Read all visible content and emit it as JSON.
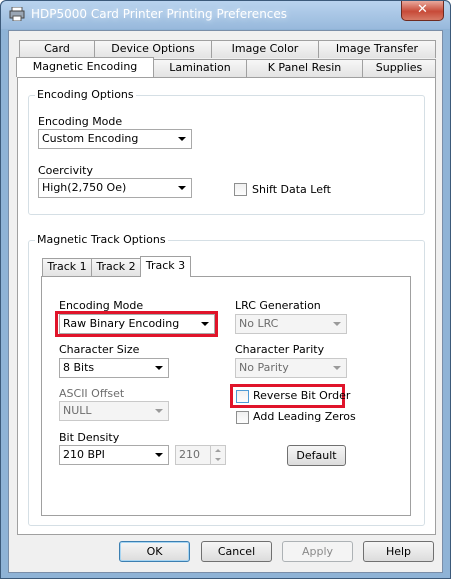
{
  "window": {
    "title": "HDP5000 Card Printer Printing Preferences",
    "close_glyph": "✕"
  },
  "tabs_row1": [
    "Card",
    "Device Options",
    "Image Color",
    "Image Transfer"
  ],
  "tabs_row2": [
    "Magnetic Encoding",
    "Lamination",
    "K Panel Resin",
    "Supplies"
  ],
  "selected_tab": "Magnetic Encoding",
  "encoding_options": {
    "title": "Encoding Options",
    "mode_label": "Encoding Mode",
    "mode_value": "Custom Encoding",
    "coercivity_label": "Coercivity",
    "coercivity_value": "High(2,750 Oe)",
    "shift_label": "Shift Data Left",
    "shift_checked": false
  },
  "track_options": {
    "title": "Magnetic Track Options",
    "tabs": [
      "Track 1",
      "Track 2",
      "Track 3"
    ],
    "selected_tab": "Track 3",
    "encoding_mode_label": "Encoding Mode",
    "encoding_mode_value": "Raw Binary Encoding",
    "lrc_label": "LRC Generation",
    "lrc_value": "No LRC",
    "char_size_label": "Character Size",
    "char_size_value": "8 Bits",
    "char_parity_label": "Character Parity",
    "char_parity_value": "No Parity",
    "ascii_offset_label": "ASCII Offset",
    "ascii_offset_value": "NULL",
    "reverse_bit_label": "Reverse Bit Order",
    "reverse_bit_checked": false,
    "leading_zeros_label": "Add Leading Zeros",
    "leading_zeros_checked": false,
    "bit_density_label": "Bit Density",
    "bit_density_value": "210 BPI",
    "bit_density_spin": "210",
    "default_label": "Default"
  },
  "buttons": {
    "ok": "OK",
    "cancel": "Cancel",
    "apply": "Apply",
    "help": "Help"
  },
  "colors": {
    "highlight": "#e0142a"
  }
}
